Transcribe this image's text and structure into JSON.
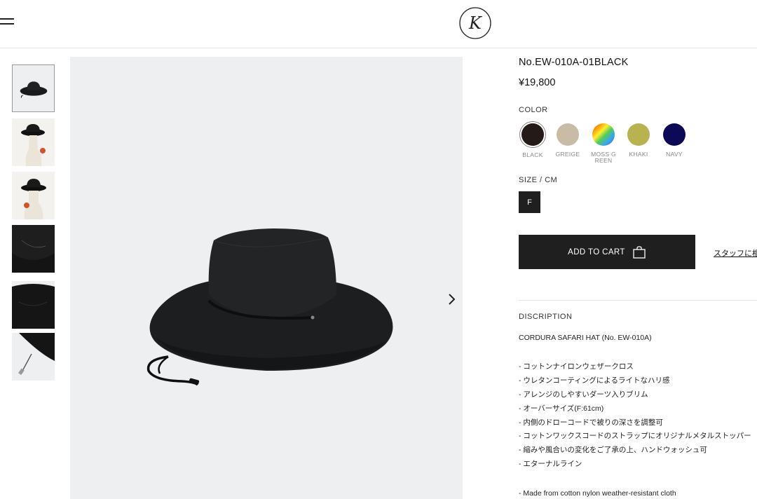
{
  "header": {
    "menu_icon": "hamburger-menu-icon",
    "logo_letter": "K"
  },
  "gallery": {
    "thumbnails": [
      {
        "alt": "hat-front",
        "active": true
      },
      {
        "alt": "hat-on-mannequin-front"
      },
      {
        "alt": "hat-on-mannequin-side"
      },
      {
        "alt": "hat-brim-detail"
      },
      {
        "alt": "hat-underside-detail"
      },
      {
        "alt": "hat-stopper-detail"
      }
    ],
    "next_icon": "chevron-right-icon"
  },
  "product": {
    "sku": "No.EW-010A-01BLACK",
    "price": "¥19,800",
    "color_label": "COLOR",
    "colors": [
      {
        "name": "BLACK",
        "hex": "#241a17",
        "selected": true
      },
      {
        "name": "GREIGE",
        "hex": "#c9bca6"
      },
      {
        "name": "MOSS G REEN",
        "hex": "rainbow"
      },
      {
        "name": "KHAKI",
        "hex": "#b8b24f"
      },
      {
        "name": "NAVY",
        "hex": "#0c0a57"
      }
    ],
    "size_label": "SIZE / CM",
    "sizes": [
      "F"
    ],
    "add_to_cart": "ADD TO CART",
    "staff_link": "スタッフに相"
  },
  "description": {
    "label": "DISCRIPTION",
    "title": "CORDURA SAFARI HAT (No. EW-010A)",
    "items": [
      "- コットンナイロンウェザークロス",
      "- ウレタンコーティングによるライトなハリ感",
      "- アレンジのしやすいダーツ入りブリム",
      "- オーバーサイズ(F:61cm)",
      "- 内側のドローコードで被りの深さを調整可",
      "- コットンワックスコードのストラップにオリジナルメタルストッパー",
      "- 縮みや風合いの変化をご了承の上、ハンドウォッシュ可",
      "- エターナルライン"
    ],
    "english_first": "- Made from cotton nylon weather-resistant cloth"
  }
}
